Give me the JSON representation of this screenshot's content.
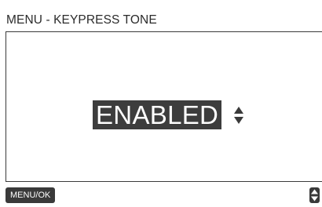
{
  "header": {
    "title": "MENU - KEYPRESS TONE"
  },
  "setting": {
    "value": "ENABLED"
  },
  "footer": {
    "softkey_label": "MENU/OK"
  },
  "icons": {
    "value_adjust": "up-down-arrows-icon",
    "scroll": "scroll-up-down-icon"
  },
  "colors": {
    "highlight": "#3d3d3d",
    "text": "#2b2b2b",
    "background": "#ffffff"
  }
}
